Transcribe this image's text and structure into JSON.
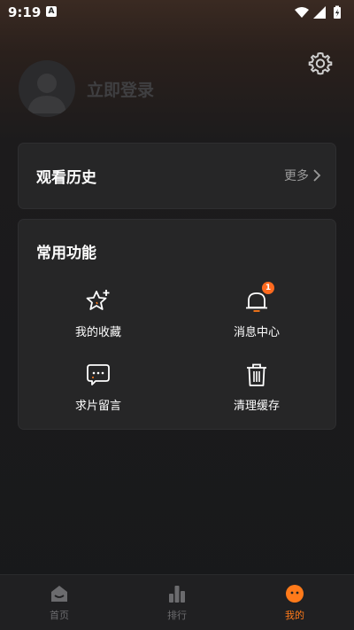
{
  "status_bar": {
    "time": "9:19",
    "notification_glyph": "A"
  },
  "header": {
    "login_text": "立即登录"
  },
  "history": {
    "title": "观看历史",
    "more_label": "更多"
  },
  "functions": {
    "title": "常用功能",
    "items": [
      {
        "label": "我的收藏",
        "icon": "star-plus-icon"
      },
      {
        "label": "消息中心",
        "icon": "bell-icon",
        "badge": "1"
      },
      {
        "label": "求片留言",
        "icon": "chat-bubble-icon"
      },
      {
        "label": "清理缓存",
        "icon": "trash-icon"
      }
    ]
  },
  "bottom_nav": {
    "items": [
      {
        "label": "首页",
        "icon": "home-icon",
        "active": false
      },
      {
        "label": "排行",
        "icon": "bar-chart-icon",
        "active": false
      },
      {
        "label": "我的",
        "icon": "profile-face-icon",
        "active": true
      }
    ]
  },
  "colors": {
    "accent": "#ff7a1a",
    "badge": "#ff6a1f",
    "card": "#262627"
  }
}
